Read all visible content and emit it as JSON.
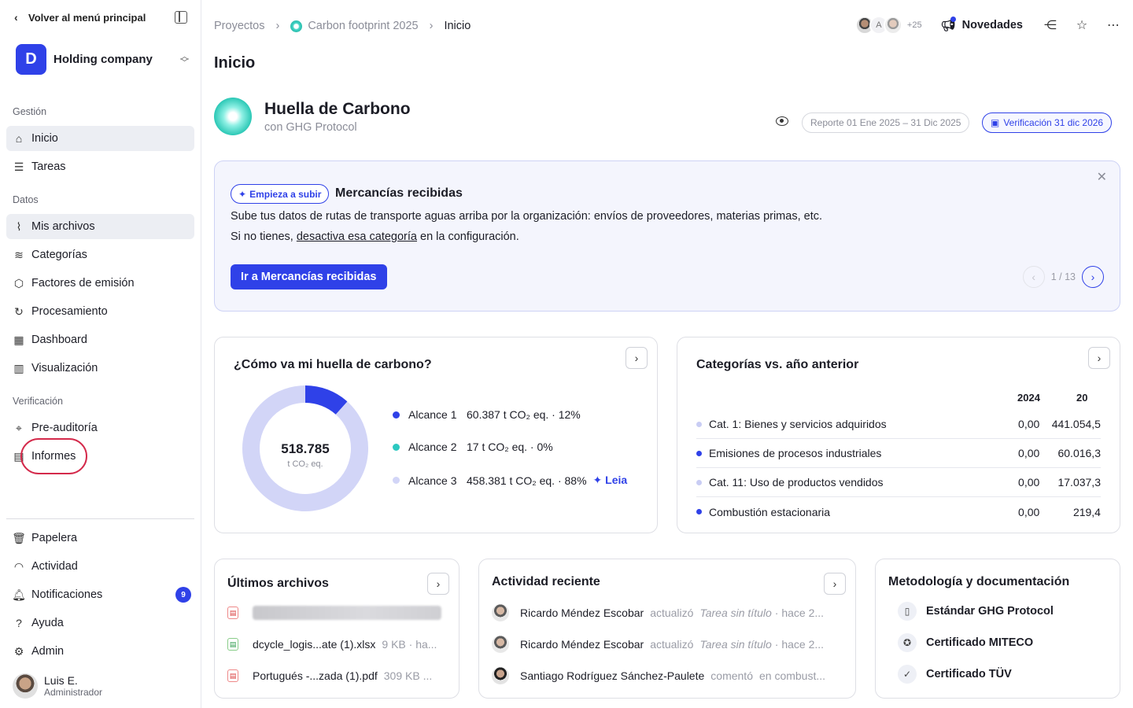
{
  "sidebar": {
    "back_label": "Volver al menú principal",
    "org_initial": "D",
    "org_name": "Holding company",
    "sections": {
      "gestion": "Gestión",
      "datos": "Datos",
      "verificacion": "Verificación"
    },
    "items": {
      "inicio": "Inicio",
      "tareas": "Tareas",
      "mis_archivos": "Mis archivos",
      "categorias": "Categorías",
      "factores": "Factores de emisión",
      "procesamiento": "Procesamiento",
      "dashboard": "Dashboard",
      "visualizacion": "Visualización",
      "preauditoria": "Pre-auditoría",
      "informes": "Informes",
      "papelera": "Papelera",
      "actividad": "Actividad",
      "notificaciones": "Notificaciones",
      "ayuda": "Ayuda",
      "admin": "Admin"
    },
    "notifications_count": "9",
    "user": {
      "name": "Luis E.",
      "role": "Administrador"
    }
  },
  "header": {
    "breadcrumb": [
      "Proyectos",
      "Carbon footprint 2025",
      "Inicio"
    ],
    "avatar_initial": "A",
    "members_more": "+25",
    "news_label": "Novedades"
  },
  "page_title": "Inicio",
  "hero": {
    "title": "Huella de Carbono",
    "subtitle": "con GHG Protocol",
    "report_range": "Reporte 01 Ene 2025 – 31 Dic 2025",
    "verification": "Verificación 31 dic 2026"
  },
  "banner": {
    "chip": "Empieza a subir",
    "title": "Mercancías recibidas",
    "line1": "Sube tus datos de rutas de transporte aguas arriba por la organización: envíos de proveedores, materias primas, etc.",
    "line2_prefix": "Si no tienes, ",
    "line2_link": "desactiva esa categoría",
    "line2_suffix": " en la configuración.",
    "button": "Ir a Mercancías recibidas",
    "pager": "1 / 13"
  },
  "footprint": {
    "title": "¿Cómo va mi huella de carbono?",
    "total": "518.785",
    "unit": "t CO₂ eq.",
    "leia_label": "Leia"
  },
  "chart_data": {
    "type": "pie",
    "categories": [
      "Alcance 1",
      "Alcance 2",
      "Alcance 3"
    ],
    "values": [
      60387,
      17,
      458381
    ],
    "labels": [
      "60.387 t CO₂ eq. · 12%",
      "17 t CO₂ eq. · 0%",
      "458.381 t CO₂ eq. · 88%"
    ],
    "colors": [
      "#2f41e8",
      "#2cc8c0",
      "#d2d5f7"
    ]
  },
  "categories_card": {
    "title": "Categorías vs. año anterior",
    "col1": "2024",
    "col2": "20",
    "rows": [
      {
        "name": "Cat. 1: Bienes y servicios adquiridos",
        "v2024": "0,00",
        "v2025": "441.054,5",
        "color": "#c9cdf4"
      },
      {
        "name": "Emisiones de procesos industriales",
        "v2024": "0,00",
        "v2025": "60.016,3",
        "color": "#2f41e8"
      },
      {
        "name": "Cat. 11: Uso de productos vendidos",
        "v2024": "0,00",
        "v2025": "17.037,3",
        "color": "#c9cdf4"
      },
      {
        "name": "Combustión estacionaria",
        "v2024": "0,00",
        "v2025": "219,4",
        "color": "#2f41e8"
      }
    ]
  },
  "files": {
    "title": "Últimos archivos",
    "rows": [
      {
        "name": "dcycle_logis...ate (1).xlsx",
        "meta": "9 KB · ha..."
      },
      {
        "name": "Portugués -...zada (1).pdf",
        "meta": "309 KB ..."
      }
    ]
  },
  "activity": {
    "title": "Actividad reciente",
    "rows": [
      {
        "user": "Ricardo Méndez Escobar",
        "verb": "actualizó",
        "object": "Tarea sin título",
        "when": "· hace 2..."
      },
      {
        "user": "Ricardo Méndez Escobar",
        "verb": "actualizó",
        "object": "Tarea sin título",
        "when": "· hace 2..."
      },
      {
        "user": "Santiago Rodríguez Sánchez-Paulete",
        "verb": "comentó",
        "object": "en combust..."
      }
    ]
  },
  "methodology": {
    "title": "Metodología y documentación",
    "items": [
      "Estándar GHG Protocol",
      "Certificado MITECO",
      "Certificado TÜV"
    ]
  }
}
